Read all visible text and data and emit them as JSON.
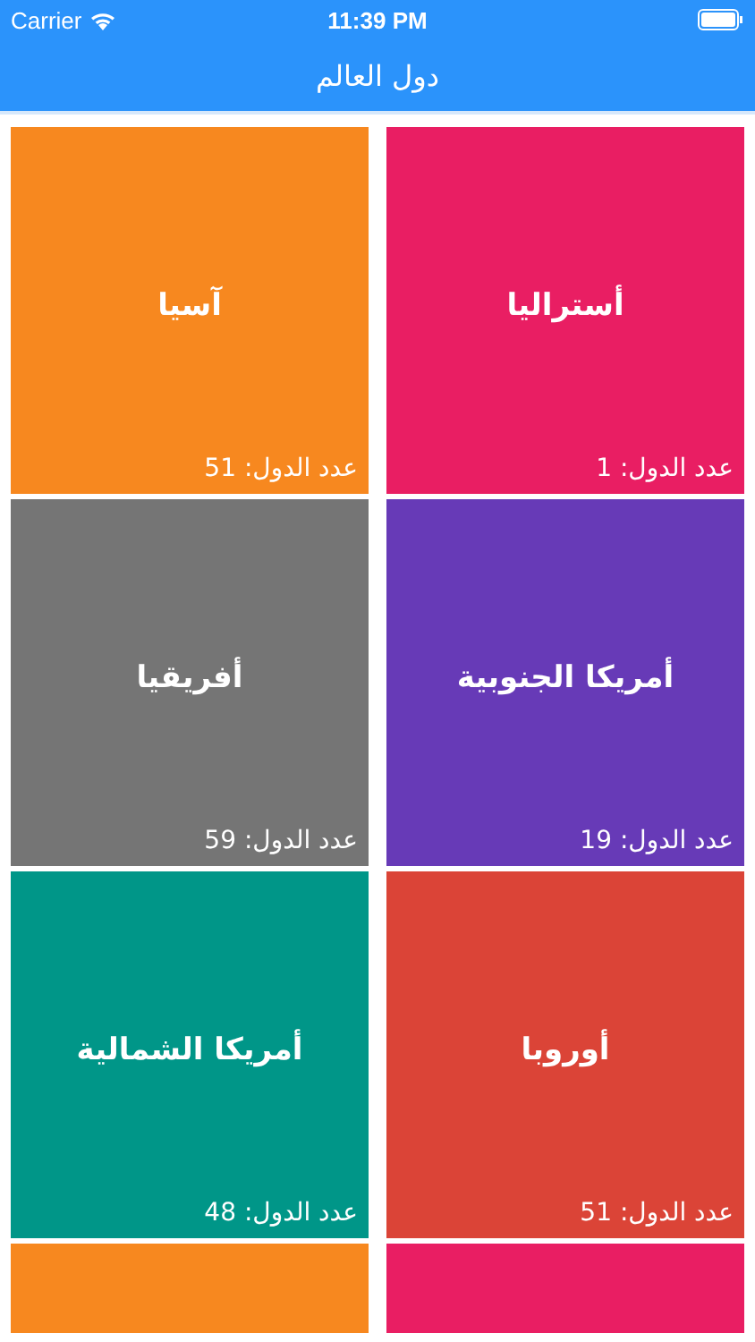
{
  "status_bar": {
    "carrier": "Carrier",
    "time": "11:39 PM"
  },
  "nav_bar": {
    "title": "دول العالم"
  },
  "continents": [
    {
      "name": "أستراليا",
      "count": "عدد الدول: 1",
      "color": "#e91e63"
    },
    {
      "name": "آسيا",
      "count": "عدد الدول: 51",
      "color": "#f7881f"
    },
    {
      "name": "أمريكا الجنوبية",
      "count": "عدد الدول: 19",
      "color": "#673ab7"
    },
    {
      "name": "أفريقيا",
      "count": "عدد الدول: 59",
      "color": "#757575"
    },
    {
      "name": "أوروبا",
      "count": "عدد الدول: 51",
      "color": "#db4437"
    },
    {
      "name": "أمريكا الشمالية",
      "count": "عدد الدول: 48",
      "color": "#009688"
    },
    {
      "color": "#e91e63"
    },
    {
      "color": "#f7881f"
    }
  ]
}
